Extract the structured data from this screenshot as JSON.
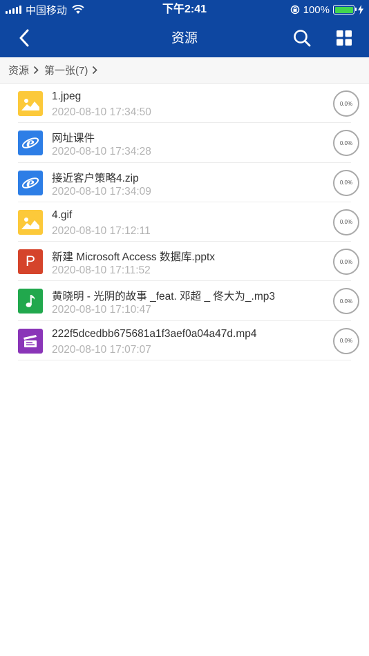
{
  "status_bar": {
    "carrier": "中国移动",
    "time": "下午2:41",
    "battery": "100%"
  },
  "nav": {
    "title": "资源",
    "icons": [
      "back-arrow-icon",
      "search-icon",
      "grid-icon"
    ]
  },
  "breadcrumb": {
    "items": [
      {
        "label": "资源"
      },
      {
        "label": "第一张(7)"
      }
    ]
  },
  "files": [
    {
      "name": "1.jpeg",
      "date": "2020-08-10 17:34:50",
      "progress": "0.0%",
      "icon": "image-icon"
    },
    {
      "name": "网址课件",
      "date": "2020-08-10 17:34:28",
      "progress": "0.0%",
      "icon": "internet-explorer-icon"
    },
    {
      "name": "接近客户策略4.zip",
      "date": "2020-08-10 17:34:09",
      "progress": "0.0%",
      "icon": "internet-explorer-icon"
    },
    {
      "name": "4.gif",
      "date": "2020-08-10 17:12:11",
      "progress": "0.0%",
      "icon": "image-icon"
    },
    {
      "name": "新建 Microsoft Access 数据库.pptx",
      "date": "2020-08-10 17:11:52",
      "progress": "0.0%",
      "icon": "powerpoint-icon",
      "icon_letter": "P"
    },
    {
      "name": "黄晓明 - 光阴的故事 _feat. 邓超 _ 佟大为_.mp3",
      "date": "2020-08-10 17:10:47",
      "progress": "0.0%",
      "icon": "music-icon"
    },
    {
      "name": "222f5dcedbb675681a1f3aef0a04a47d.mp4",
      "date": "2020-08-10 17:07:07",
      "progress": "0.0%",
      "icon": "video-icon"
    }
  ],
  "colors": {
    "header": "#0e47a1",
    "image_icon": "#fcc93a",
    "ie_icon": "#2d7ee6",
    "ppt_icon": "#d5442b",
    "music_icon": "#21a84d",
    "video_icon": "#8a35b8"
  }
}
